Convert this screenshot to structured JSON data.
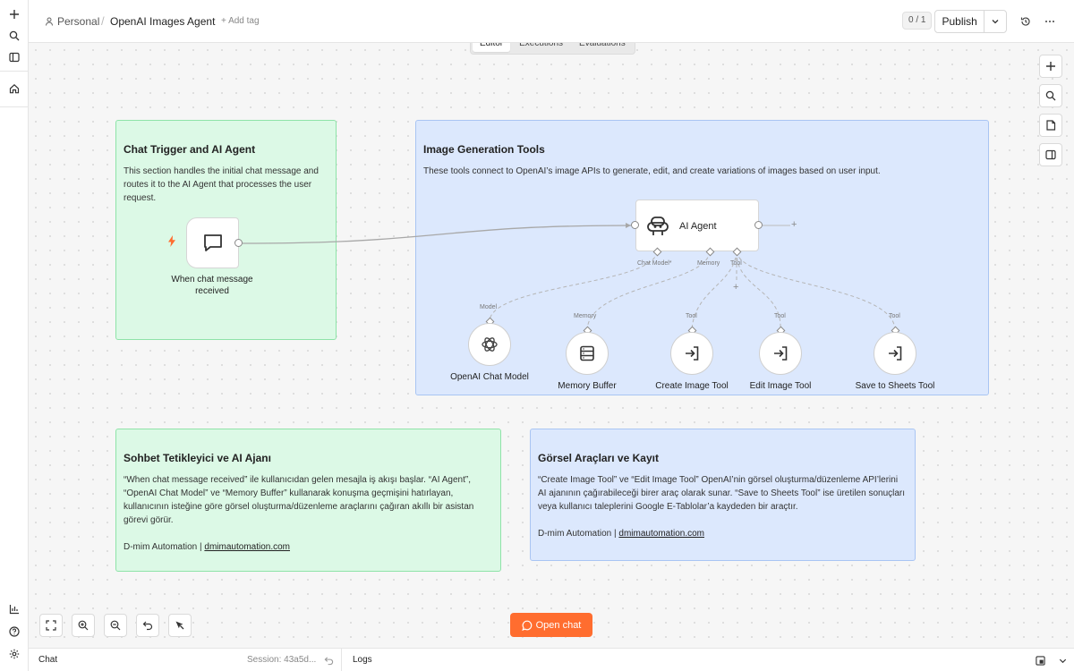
{
  "header": {
    "project": "Personal",
    "workflow_name": "OpenAI Images Agent",
    "add_tag": "+ Add tag",
    "counter": "0 / 1",
    "publish_label": "Publish"
  },
  "tabs": [
    "Editor",
    "Executions",
    "Evaluations"
  ],
  "stickies": {
    "trigger": {
      "title": "Chat Trigger and AI Agent",
      "body": "This section handles the initial chat message and routes it to the AI Agent that processes the user request."
    },
    "tools": {
      "title": "Image Generation Tools",
      "body": "These tools connect to OpenAI’s image APIs to generate, edit, and create variations of images based on user input."
    },
    "tr_left": {
      "title": "Sohbet Tetikleyici ve AI Ajanı",
      "body": "“When chat message received” ile kullanıcıdan gelen mesajla iş akışı başlar. “AI Agent”, “OpenAI Chat Model” ve “Memory Buffer” kullanarak konuşma geçmişini hatırlayan, kullanıcının isteğine göre görsel oluşturma/düzenleme araçlarını çağıran akıllı bir asistan görevi görür.",
      "sig_prefix": "D-mim Automation | ",
      "sig_link": "dmimautomation.com"
    },
    "tr_right": {
      "title": "Görsel Araçları ve Kayıt",
      "body": "“Create Image Tool” ve “Edit Image Tool” OpenAI’nin görsel oluşturma/düzenleme API’lerini AI ajanının çağırabileceği birer araç olarak sunar. “Save to Sheets Tool” ise üretilen sonuçları veya kullanıcı taleplerini Google E-Tablolar’a kaydeden bir araçtır.",
      "sig_prefix": "D-mim Automation | ",
      "sig_link": "dmimautomation.com"
    }
  },
  "nodes": {
    "trigger": {
      "label_line1": "When chat message",
      "label_line2": "received"
    },
    "agent": {
      "label": "AI Agent",
      "port_chat_model": "Chat Model*",
      "port_memory": "Memory",
      "port_tool": "Tool"
    },
    "chat_model": {
      "label": "OpenAI Chat Model",
      "port": "Model"
    },
    "memory": {
      "label": "Memory Buffer",
      "port": "Memory"
    },
    "create_image": {
      "label": "Create Image Tool",
      "port": "Tool"
    },
    "edit_image": {
      "label": "Edit Image Tool",
      "port": "Tool"
    },
    "save_sheets": {
      "label": "Save to Sheets Tool",
      "port": "Tool"
    }
  },
  "open_chat": "Open chat",
  "bottom": {
    "chat": "Chat",
    "session": "Session: 43a5d...",
    "logs": "Logs"
  },
  "colors": {
    "accent": "#ff6d2f",
    "sticky_green": "#dcf9e6",
    "sticky_blue": "#dce8fd"
  }
}
